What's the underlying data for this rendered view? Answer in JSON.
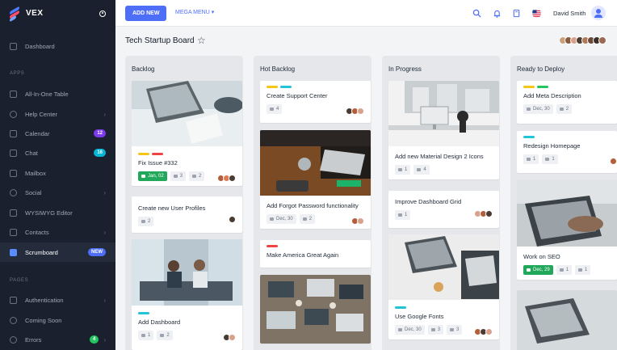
{
  "app": {
    "brand": "VEX"
  },
  "sidebar": {
    "dashboard": "Dashboard",
    "section_apps": "APPS",
    "items": [
      {
        "label": "All-In-One Table"
      },
      {
        "label": "Help Center"
      },
      {
        "label": "Calendar",
        "badge": "12"
      },
      {
        "label": "Chat",
        "badge": "16"
      },
      {
        "label": "Mailbox"
      },
      {
        "label": "Social"
      },
      {
        "label": "WYSIWYG Editor"
      },
      {
        "label": "Contacts"
      },
      {
        "label": "Scrumboard",
        "badge": "NEW"
      }
    ],
    "section_pages": "PAGES",
    "pages": [
      {
        "label": "Authentication"
      },
      {
        "label": "Coming Soon"
      },
      {
        "label": "Errors",
        "badge": "4"
      }
    ]
  },
  "topbar": {
    "add_new": "ADD NEW",
    "mega_menu": "MEGA MENU",
    "user": "David Smith"
  },
  "board": {
    "title": "Tech Startup Board",
    "columns": [
      {
        "title": "Backlog",
        "cards": [
          {
            "title": "Fix Issue #332",
            "date": "Jan, 02",
            "comments": "3",
            "attachments": "2"
          },
          {
            "title": "Create new User Profiles",
            "comments": "2"
          },
          {
            "title": "Add Dashboard",
            "comments": "1",
            "attachments": "2"
          }
        ]
      },
      {
        "title": "Hot Backlog",
        "cards": [
          {
            "title": "Create Support Center",
            "comments": "4"
          },
          {
            "title": "Add Forgot Password functionality",
            "date": "Dec, 30",
            "attachments": "2"
          },
          {
            "title": "Make America Great Again"
          }
        ]
      },
      {
        "title": "In Progress",
        "cards": [
          {
            "title": "Add new Material Design 2 Icons",
            "comments": "1",
            "attachments": "4"
          },
          {
            "title": "Improve Dashboard Grid",
            "comments": "1"
          },
          {
            "title": "Use Google Fonts",
            "date": "Dec, 30",
            "comments": "3",
            "attachments": "3"
          }
        ]
      },
      {
        "title": "Ready to Deploy",
        "cards": [
          {
            "title": "Add Meta Description",
            "date": "Dec, 30",
            "attachments": "2"
          },
          {
            "title": "Redesign Homepage",
            "comments": "1",
            "attachments": "1"
          },
          {
            "title": "Work on SEO",
            "date": "Dec, 29",
            "comments": "1",
            "attachments": "1"
          }
        ]
      }
    ]
  },
  "colors": {
    "accent": "#4f6ef7",
    "sidebar": "#1a202e",
    "calendar_badge": "#7c3aed",
    "chat_badge": "#06b6d4",
    "new_badge": "#4f6ef7",
    "errors_badge": "#22c55e"
  }
}
